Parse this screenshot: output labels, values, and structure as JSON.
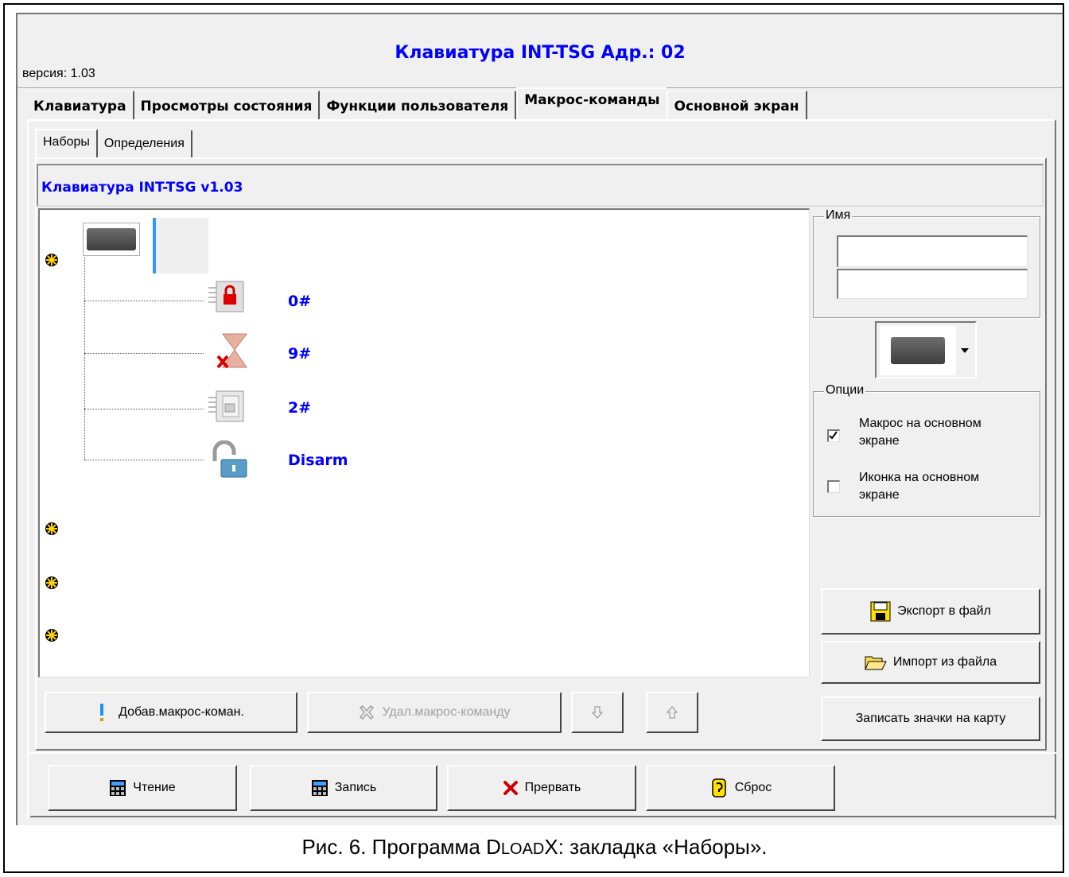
{
  "window": {
    "title": "Клавиатура INT-TSG Адр.: 02",
    "version": "версия: 1.03"
  },
  "main_tabs": [
    {
      "label": "Клавиатура",
      "active": false
    },
    {
      "label": "Просмотры состояния",
      "active": false
    },
    {
      "label": "Функции пользователя",
      "active": false
    },
    {
      "label": "Макрос-команды",
      "active": true
    },
    {
      "label": "Основной экран",
      "active": false
    }
  ],
  "sub_tabs": [
    {
      "label": "Наборы",
      "active": true
    },
    {
      "label": "Определения",
      "active": false
    }
  ],
  "header": {
    "text": "Клавиатура INT-TSG v1.03"
  },
  "tree": {
    "groups": 4,
    "macros": [
      {
        "label": "0#",
        "icon": "arm-lock-icon"
      },
      {
        "label": "9#",
        "icon": "hourglass-cancel-icon"
      },
      {
        "label": "2#",
        "icon": "unlock-icon"
      },
      {
        "label": "Disarm",
        "icon": "padlock-open-icon"
      }
    ]
  },
  "name_group": {
    "label": "Имя",
    "line1": "",
    "line2": ""
  },
  "options_group": {
    "label": "Опции",
    "macro_on_main": {
      "line1": "Макрос на основном",
      "line2": "экране",
      "checked": true
    },
    "icon_on_main": {
      "line1": "Иконка на основном",
      "line2": "экране",
      "checked": false
    }
  },
  "buttons": {
    "add_macro": "Добав.макрос-коман.",
    "delete_macro": "Удал.макрос-команду",
    "export": "Экспорт в файл",
    "import": "Импорт из файла",
    "write_icons": "Записать значки на карту",
    "read": "Чтение",
    "write": "Запись",
    "abort": "Прервать",
    "reset": "Сброс"
  },
  "caption": {
    "prefix": "Рис. 6. Программа ",
    "app_d": "D",
    "app_load": "LOAD",
    "app_x": "X",
    "suffix": ": закладка «Наборы»."
  }
}
